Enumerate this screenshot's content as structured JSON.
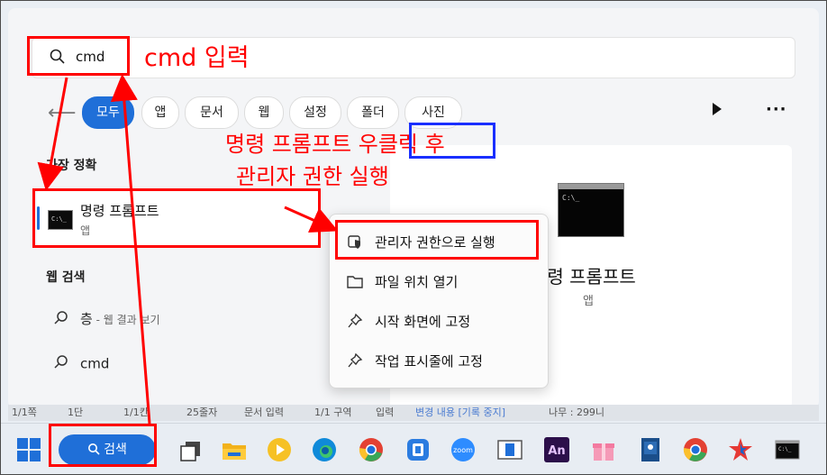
{
  "search": {
    "query": "cmd"
  },
  "filters": {
    "back_icon": "back-arrow-icon",
    "chips": [
      {
        "label": "모두",
        "active": true
      },
      {
        "label": "앱",
        "active": false
      },
      {
        "label": "문서",
        "active": false
      },
      {
        "label": "웹",
        "active": false
      },
      {
        "label": "설정",
        "active": false
      },
      {
        "label": "폴더",
        "active": false
      },
      {
        "label": "사진",
        "active": false
      }
    ]
  },
  "best_match": {
    "heading": "가장 정확",
    "result": {
      "title": "명령 프롬프트",
      "subtitle": "앱"
    }
  },
  "web_search": {
    "heading": "웹 검색",
    "rows": [
      {
        "text": "층",
        "hint": " - 웹 결과 보기"
      },
      {
        "text": "cmd",
        "hint": ""
      }
    ]
  },
  "preview": {
    "title": "명령 프롬프트",
    "subtitle": "앱"
  },
  "context_menu": {
    "items": [
      {
        "label": "관리자 권한으로 실행",
        "icon": "shield-icon"
      },
      {
        "label": "파일 위치 열기",
        "icon": "folder-icon"
      },
      {
        "label": "시작 화면에 고정",
        "icon": "pin-icon"
      },
      {
        "label": "작업 표시줄에 고정",
        "icon": "pin-icon"
      }
    ]
  },
  "annotations": {
    "cmd_input": "cmd 입력",
    "right_click_line1_pre": "명령 프롬프트 ",
    "right_click_highlight": "우클릭",
    "right_click_line1_post": " 후",
    "right_click_line2": "관리자 권한 실행"
  },
  "status_strip": [
    "1/1쪽",
    "1단",
    "1/1칸",
    "25줄자",
    "문서 입력",
    "1/1 구역",
    "입력",
    "변경 내용 [기록 중지]",
    "나무 : 299니"
  ],
  "taskbar": {
    "search_label": "검색",
    "apps": [
      "windows-start-icon",
      "task-view-icon",
      "file-explorer-icon",
      "media-player-icon",
      "edge-icon",
      "chrome-icon",
      "app-icon",
      "zoom-icon",
      "screen-icon",
      "animate-icon",
      "gift-icon",
      "book-icon",
      "chrome-icon",
      "star-app-icon",
      "terminal-icon"
    ],
    "zoom_text": "zoom",
    "animate_text": "An"
  },
  "colors": {
    "accent": "#1f6fd8",
    "annotation_red": "#ff0000",
    "annotation_blue": "#1a2fff"
  }
}
